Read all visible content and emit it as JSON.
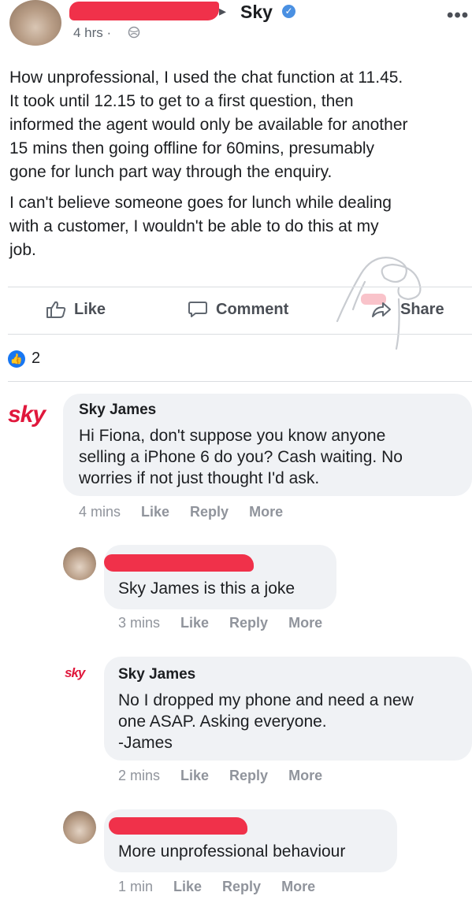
{
  "post": {
    "page_name": "Sky",
    "separator": "▸",
    "time": "4 hrs ·",
    "more_icon": "•••",
    "paragraph1": "How unprofessional, I used the chat function at 11.45.\nIt took until 12.15 to get to a first question, then\ninformed the agent would only be available for another\n15 mins then going offline for 60mins, presumably\ngone for lunch part way through the enquiry.",
    "paragraph2": "I can't believe someone goes for lunch while dealing\nwith a customer, I wouldn't be able to do this at my\njob."
  },
  "actions": {
    "like": "Like",
    "comment": "Comment",
    "share": "Share"
  },
  "reactions": {
    "count": "2"
  },
  "comments": [
    {
      "logo": "sky",
      "name": "Sky James",
      "text": "Hi Fiona, don't suppose you know anyone\nselling a iPhone 6 do you? Cash waiting. No\nworries if not just thought I'd ask.",
      "time": "4 mins",
      "like": "Like",
      "reply": "Reply",
      "more": "More"
    },
    {
      "text": "Sky James is this a joke",
      "time": "3 mins",
      "like": "Like",
      "reply": "Reply",
      "more": "More"
    },
    {
      "logo": "sky",
      "name": "Sky James",
      "text": "No I dropped my phone and need a new\none ASAP. Asking everyone.\n-James",
      "time": "2 mins",
      "like": "Like",
      "reply": "Reply",
      "more": "More"
    },
    {
      "text": "More unprofessional behaviour",
      "time": "1 min",
      "like": "Like",
      "reply": "Reply",
      "more": "More"
    }
  ],
  "colors": {
    "redaction": "#f0314a",
    "sky_brand": "#e0183c",
    "facebook_blue": "#1877f2"
  },
  "icons": {
    "verified": "verified-badge-icon",
    "globe": "globe-icon",
    "like": "thumbs-up-icon",
    "comment": "comment-bubble-icon",
    "share": "share-arrow-icon"
  }
}
